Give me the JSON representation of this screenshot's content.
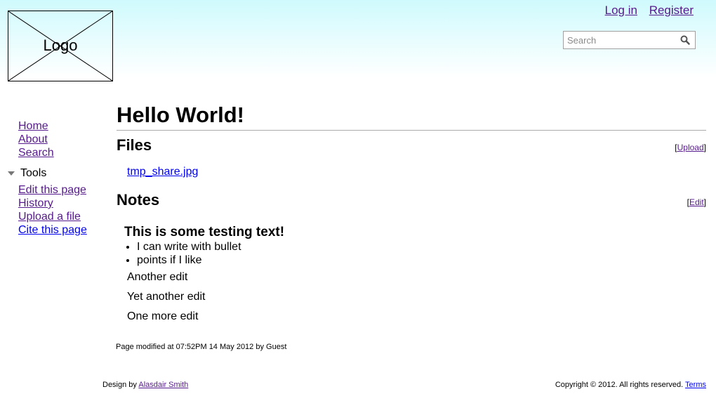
{
  "header": {
    "logo_text": "Logo",
    "login": "Log in",
    "register": "Register",
    "search_placeholder": "Search",
    "search_icon": "magnifier-icon"
  },
  "sidebar": {
    "nav": [
      "Home",
      "About",
      "Search"
    ],
    "tools_label": "Tools",
    "tools": [
      "Edit this page",
      "History",
      "Upload a file",
      "Cite this page"
    ]
  },
  "main": {
    "title": "Hello World!",
    "files_heading": "Files",
    "upload_link": "Upload",
    "file_name": "tmp_share.jpg",
    "notes_heading": "Notes",
    "edit_link": "Edit",
    "notes": {
      "heading": "This is some testing text!",
      "bullets": [
        "I can write with bullet",
        "points if I like"
      ],
      "paragraphs": [
        "Another edit",
        "Yet another edit",
        "One more edit"
      ]
    },
    "modified": "Page modified at 07:52PM 14 May 2012 by Guest"
  },
  "footer": {
    "design_prefix": "Design by ",
    "designer": "Alasdair Smith",
    "copyright": "Copyright © 2012. All rights reserved. ",
    "terms": "Terms"
  }
}
